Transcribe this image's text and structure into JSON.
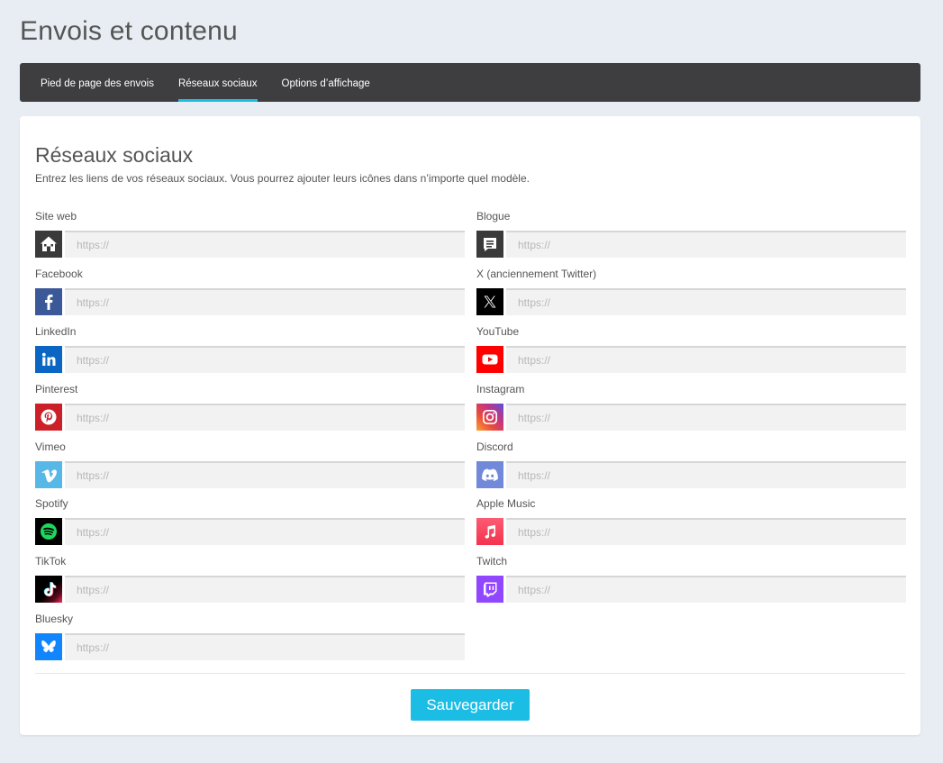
{
  "page": {
    "title": "Envois et contenu"
  },
  "tabs": [
    {
      "label": "Pied de page des envois"
    },
    {
      "label": "Réseaux sociaux",
      "active": true
    },
    {
      "label": "Options d’affichage"
    }
  ],
  "section": {
    "title": "Réseaux sociaux",
    "description": "Entrez les liens de vos réseaux sociaux. Vous pourrez ajouter leurs icônes dans n’importe quel modèle."
  },
  "fields": [
    {
      "label": "Site web",
      "placeholder": "https://",
      "value": "",
      "icon": "home-icon",
      "color": "#3a3a3a"
    },
    {
      "label": "Blogue",
      "placeholder": "https://",
      "value": "",
      "icon": "blog-icon",
      "color": "#3a3a3a"
    },
    {
      "label": "Facebook",
      "placeholder": "https://",
      "value": "",
      "icon": "facebook-icon",
      "color": "#3b5998"
    },
    {
      "label": "X (anciennement Twitter)",
      "placeholder": "https://",
      "value": "",
      "icon": "x-icon",
      "color": "#000000"
    },
    {
      "label": "LinkedIn",
      "placeholder": "https://",
      "value": "",
      "icon": "linkedin-icon",
      "color": "#0a66c2"
    },
    {
      "label": "YouTube",
      "placeholder": "https://",
      "value": "",
      "icon": "youtube-icon",
      "color": "#ff0000"
    },
    {
      "label": "Pinterest",
      "placeholder": "https://",
      "value": "",
      "icon": "pinterest-icon",
      "color": "#cb2027"
    },
    {
      "label": "Instagram",
      "placeholder": "https://",
      "value": "",
      "icon": "instagram-icon",
      "color": "#c13584"
    },
    {
      "label": "Vimeo",
      "placeholder": "https://",
      "value": "",
      "icon": "vimeo-icon",
      "color": "#57b7e6"
    },
    {
      "label": "Discord",
      "placeholder": "https://",
      "value": "",
      "icon": "discord-icon",
      "color": "#7289da"
    },
    {
      "label": "Spotify",
      "placeholder": "https://",
      "value": "",
      "icon": "spotify-icon",
      "color": "#000000"
    },
    {
      "label": "Apple Music",
      "placeholder": "https://",
      "value": "",
      "icon": "apple-music-icon",
      "color": "#f5324d"
    },
    {
      "label": "TikTok",
      "placeholder": "https://",
      "value": "",
      "icon": "tiktok-icon",
      "color": "#000000"
    },
    {
      "label": "Twitch",
      "placeholder": "https://",
      "value": "",
      "icon": "twitch-icon",
      "color": "#9146ff"
    },
    {
      "label": "Bluesky",
      "placeholder": "https://",
      "value": "",
      "icon": "bluesky-icon",
      "color": "#1185fe"
    }
  ],
  "actions": {
    "save_label": "Sauvegarder"
  },
  "colors": {
    "accent": "#1cbde5",
    "tabbar": "#3e3e40",
    "background": "#e8edf3"
  }
}
